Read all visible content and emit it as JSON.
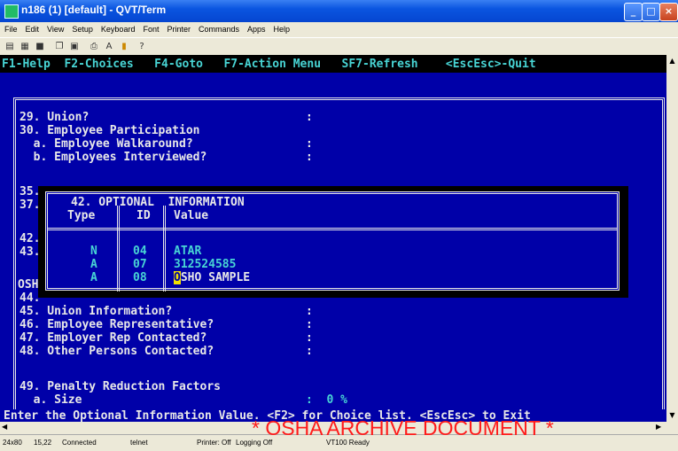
{
  "window": {
    "title": "n186 (1) [default] - QVT/Term",
    "buttons": [
      "_",
      "□",
      "×"
    ]
  },
  "menu": [
    "File",
    "Edit",
    "View",
    "Setup",
    "Keyboard",
    "Font",
    "Printer",
    "Commands",
    "Apps",
    "Help"
  ],
  "toolbar_icons": [
    "new-icon",
    "open-icon",
    "save-icon",
    "copy-icon",
    "paste-icon",
    "print-icon",
    "font-icon",
    "color-icon",
    "help-icon"
  ],
  "terminal": {
    "fkeys": "F1-Help  F2-Choices   F4-Goto   F7-Action Menu   SF7-Refresh    <EscEsc>-Quit",
    "lines": {
      "l29": "29. Union?",
      "l29_colon": ":",
      "l30": "30. Employee Participation",
      "l30a": "  a. Employee Walkaround?",
      "l30a_colon": ":",
      "l30b": "  b. Employees Interviewed?",
      "l30b_colon": ":",
      "l35": "35.",
      "l37": "37.",
      "l42": "42.",
      "l43": "43.",
      "losha": "OSHA",
      "l44": "44.",
      "l45": "45. Union Information?",
      "l45_colon": ":",
      "l46": "46. Employee Representative?",
      "l46_colon": ":",
      "l47": "47. Employer Rep Contacted?",
      "l47_colon": ":",
      "l48": "48. Other Persons Contacted?",
      "l48_colon": ":",
      "l49": "49. Penalty Reduction Factors",
      "l49a": "  a. Size",
      "l49a_value": ":  0 %"
    },
    "popup": {
      "title": "42. OPTIONAL  INFORMATION",
      "col_type": "Type",
      "col_id": "ID",
      "col_value": "Value",
      "rows": [
        {
          "type": "N",
          "id": "04",
          "value": "ATAR"
        },
        {
          "type": "A",
          "id": "07",
          "value": "312524585"
        },
        {
          "type": "A",
          "id": "08",
          "value_cursor": "O",
          "value_rest": "SHO SAMPLE"
        }
      ]
    },
    "status_message": "Enter the Optional Information Value. <F2> for Choice list. <EscEsc> to Exit"
  },
  "statusbar": {
    "size": "24x80",
    "cursor_pos": "15,22",
    "connection": "Connected",
    "protocol": "telnet",
    "printer": "Printer: Off",
    "logging": "Logging Off",
    "state": "VT100 Ready"
  },
  "watermark": "* OSHA ARCHIVE DOCUMENT *",
  "colors": {
    "terminal_blue": "#0000a8",
    "cyan": "#48d4d4",
    "cursor": "#f0e000",
    "watermark": "#ff1a1a"
  }
}
